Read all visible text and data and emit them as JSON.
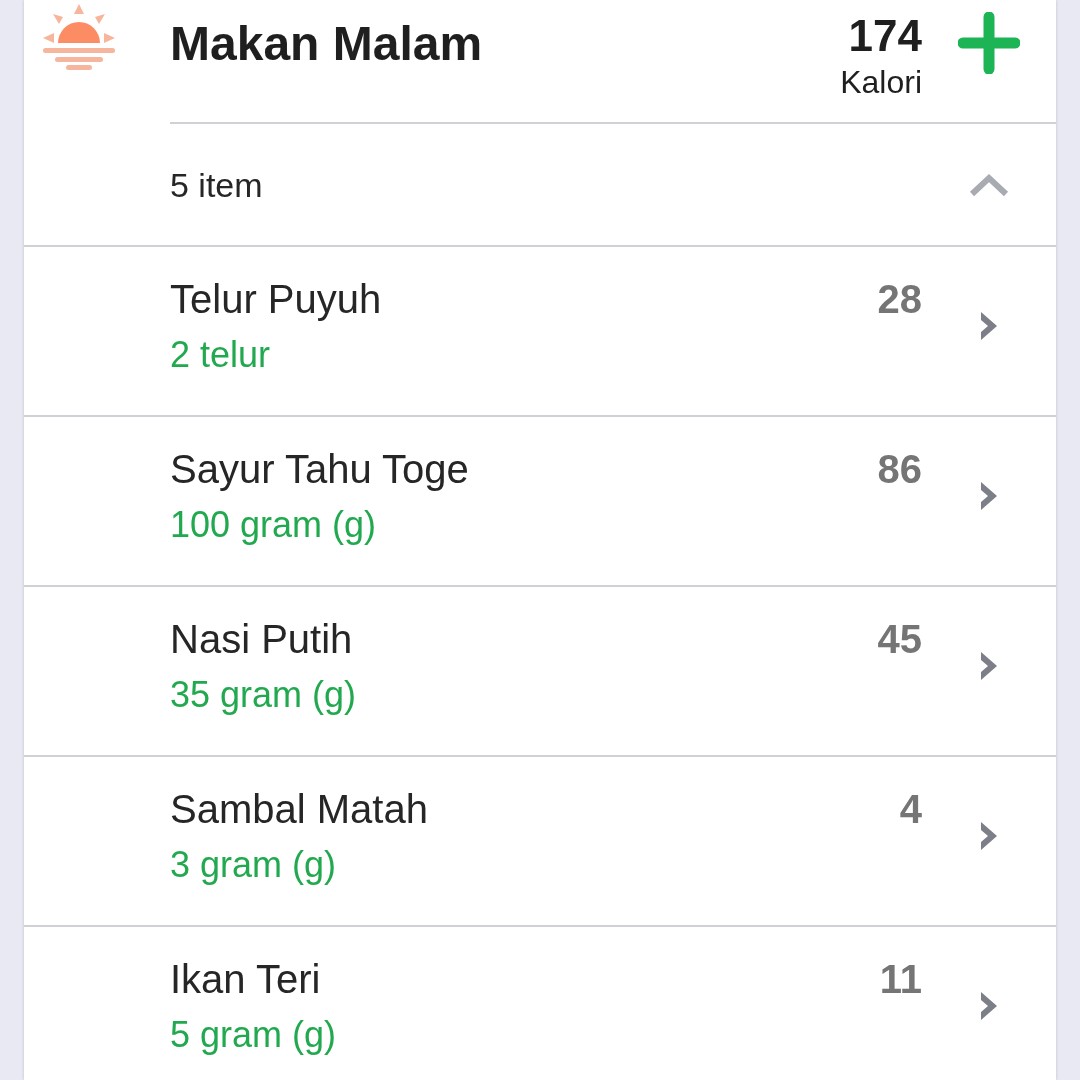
{
  "meal": {
    "title": "Makan Malam",
    "calories": "174",
    "calories_label": "Kalori"
  },
  "item_summary": {
    "label": "5 item",
    "expanded": true
  },
  "items": [
    {
      "name": "Telur Puyuh",
      "portion": "2 telur",
      "calories": "28"
    },
    {
      "name": "Sayur Tahu Toge",
      "portion": "100 gram (g)",
      "calories": "86"
    },
    {
      "name": "Nasi Putih",
      "portion": "35 gram (g)",
      "calories": "45"
    },
    {
      "name": "Sambal Matah",
      "portion": "3 gram (g)",
      "calories": "4"
    },
    {
      "name": "Ikan Teri",
      "portion": "5 gram (g)",
      "calories": "11"
    }
  ]
}
